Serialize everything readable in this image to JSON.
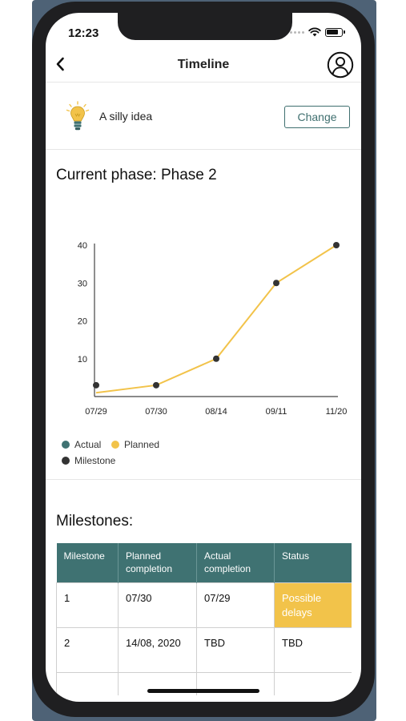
{
  "status_bar": {
    "time": "12:23"
  },
  "nav": {
    "title": "Timeline",
    "back_icon": "chevron-left-icon",
    "profile_icon": "user-circle-icon"
  },
  "idea": {
    "icon": "lightbulb-icon",
    "name": "A silly idea",
    "change_label": "Change"
  },
  "phase": {
    "title": "Current phase: Phase 2"
  },
  "colors": {
    "accent_teal": "#3f7272",
    "planned_yellow": "#f2c34a",
    "milestone_dark": "#333333"
  },
  "chart_data": {
    "type": "line",
    "categories": [
      "07/29",
      "07/30",
      "08/14",
      "09/11",
      "11/20"
    ],
    "ylim": [
      0,
      40
    ],
    "yticks": [
      10,
      20,
      30,
      40
    ],
    "series": [
      {
        "name": "Planned",
        "values": [
          1,
          3,
          10,
          30,
          40
        ]
      }
    ],
    "milestones": [
      3,
      3,
      10,
      30,
      40
    ],
    "legend": [
      "Actual",
      "Planned",
      "Milestone"
    ],
    "legend_position": "bottom-left",
    "grid": false
  },
  "legend": {
    "actual": "Actual",
    "planned": "Planned",
    "milestone": "Milestone"
  },
  "milestones": {
    "title": "Milestones:",
    "headers": [
      "Milestone",
      "Planned completion",
      "Actual completion",
      "Status"
    ],
    "rows": [
      {
        "milestone": "1",
        "planned": "07/30",
        "actual": "07/29",
        "status": "Possible delays"
      },
      {
        "milestone": "2",
        "planned": "14/08, 2020",
        "actual": "TBD",
        "status": "TBD"
      }
    ]
  }
}
